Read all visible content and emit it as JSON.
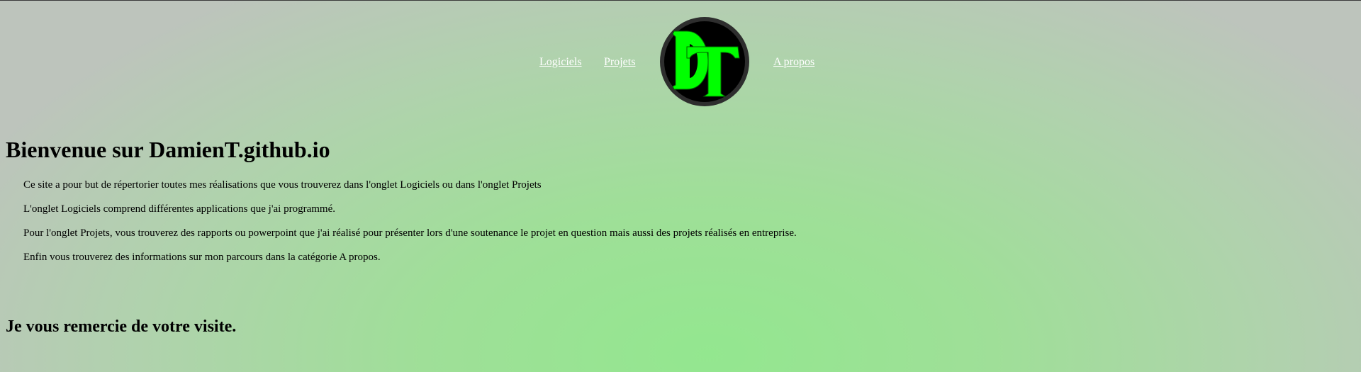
{
  "nav": {
    "logiciels": "Logiciels",
    "projets": "Projets",
    "apropos": "A propos",
    "logo_icon": "dt-monogram-logo",
    "logo_color": "#00ff00"
  },
  "main": {
    "title": "Bienvenue sur DamienT.github.io",
    "paragraphs": [
      "Ce site a pour but de répertorier toutes mes réalisations que vous trouverez dans l'onglet Logiciels ou dans l'onglet Projets",
      "L'onglet Logiciels comprend différentes applications que j'ai programmé.",
      "Pour l'onglet Projets, vous trouverez des rapports ou powerpoint que j'ai réalisé pour présenter lors d'une soutenance le projet en question mais aussi des projets réalisés en entreprise.",
      "Enfin vous trouverez des informations sur mon parcours dans la catégorie A propos."
    ],
    "closing": "Je vous remercie de votre visite."
  }
}
